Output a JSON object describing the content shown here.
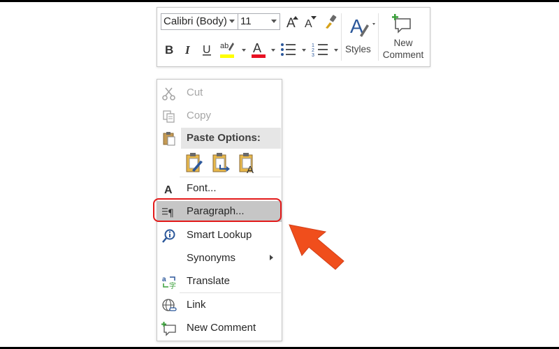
{
  "toolbar": {
    "font_name": "Calibri (Body)",
    "font_size": "11",
    "styles_label": "Styles",
    "new_comment_line1": "New",
    "new_comment_line2": "Comment",
    "highlight_color": "#ffff00",
    "font_color": "#e81123"
  },
  "menu": {
    "cut": "Cut",
    "copy": "Copy",
    "paste_options": "Paste Options:",
    "font": "Font...",
    "paragraph": "Paragraph...",
    "smart_lookup": "Smart Lookup",
    "synonyms": "Synonyms",
    "translate": "Translate",
    "link": "Link",
    "new_comment": "New Comment"
  },
  "annotation": {
    "outline_color": "#e31a1a",
    "arrow_color": "#f04e1c"
  }
}
